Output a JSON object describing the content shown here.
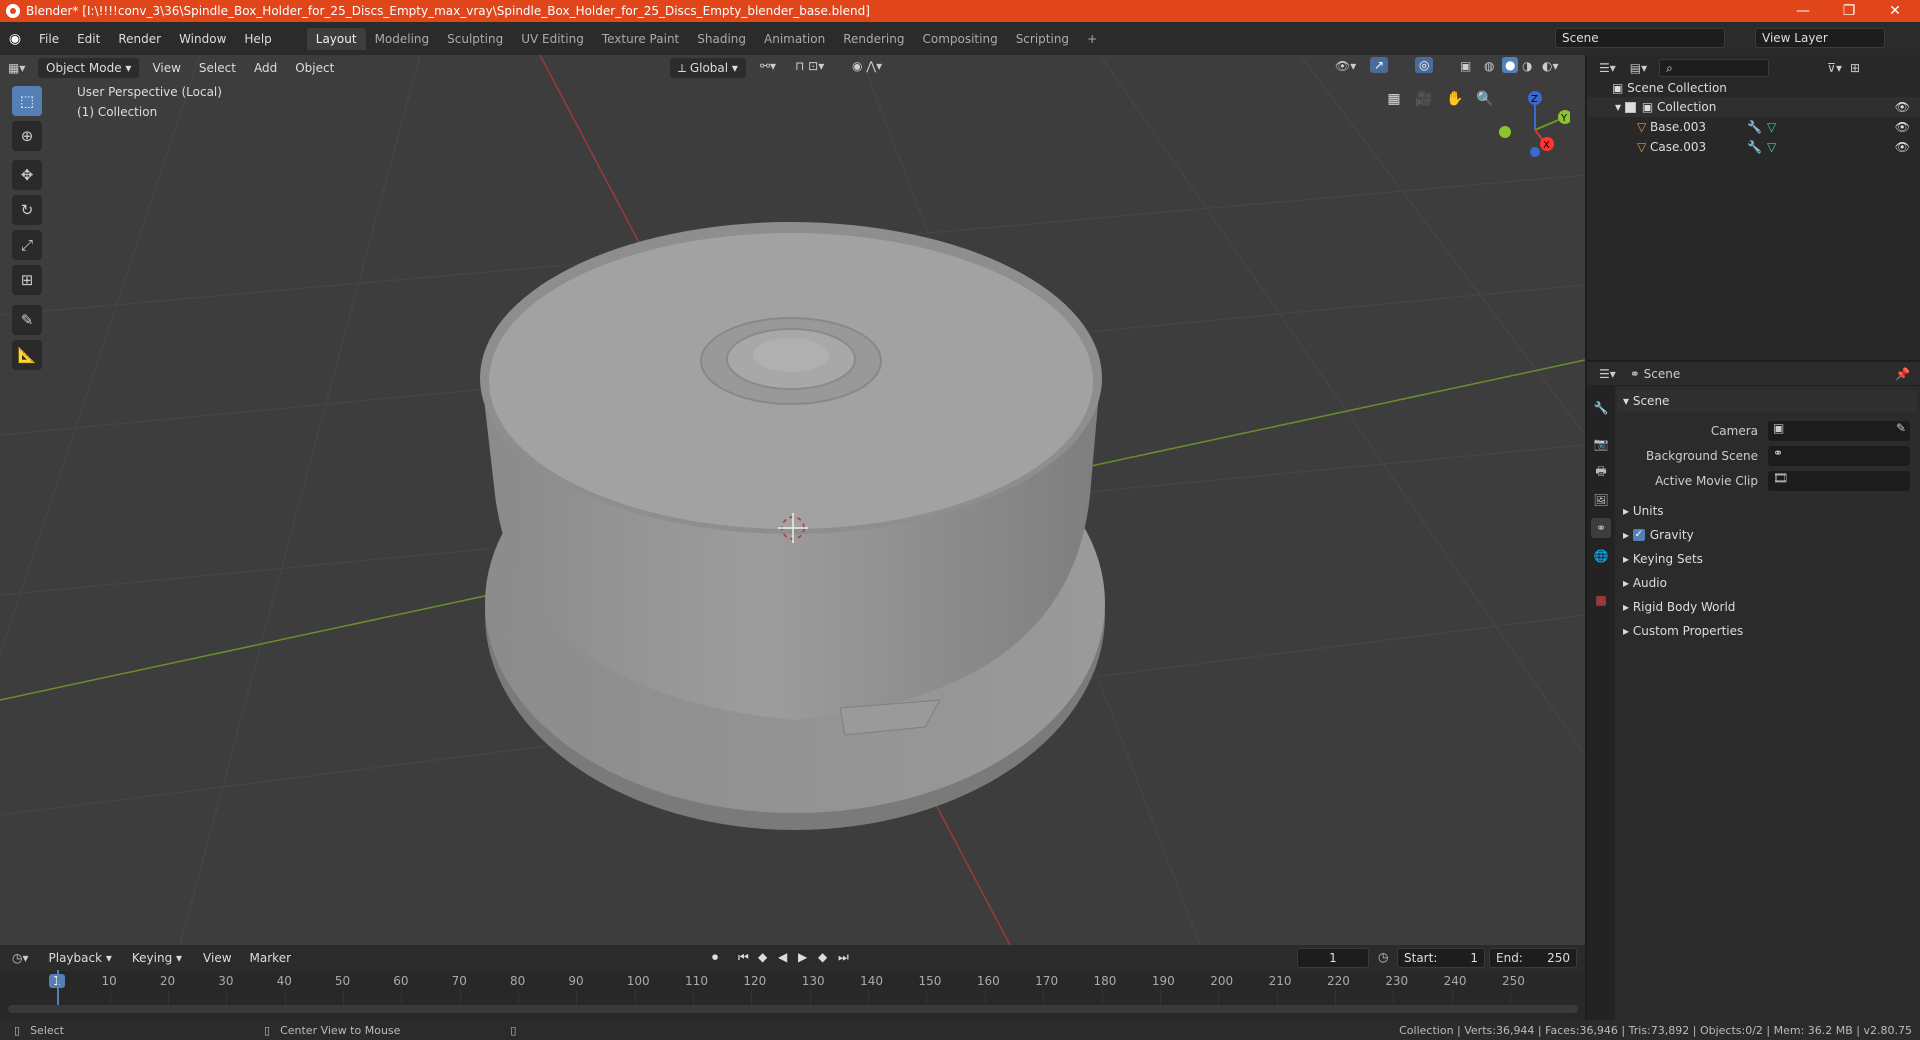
{
  "titlebar": {
    "title": "Blender* [I:\\!!!!conv_3\\36\\Spindle_Box_Holder_for_25_Discs_Empty_max_vray\\Spindle_Box_Holder_for_25_Discs_Empty_blender_base.blend]",
    "accent": "#e1461a"
  },
  "menu": [
    "File",
    "Edit",
    "Render",
    "Window",
    "Help"
  ],
  "workspaces": [
    "Layout",
    "Modeling",
    "Sculpting",
    "UV Editing",
    "Texture Paint",
    "Shading",
    "Animation",
    "Rendering",
    "Compositing",
    "Scripting"
  ],
  "active_workspace": "Layout",
  "scene_field": "Scene",
  "view_layer_field": "View Layer",
  "viewport": {
    "mode": "Object Mode",
    "menus": [
      "View",
      "Select",
      "Add",
      "Object"
    ],
    "orientation": "Global",
    "overlay_line1": "User Perspective (Local)",
    "overlay_line2": "(1) Collection",
    "gizmo": {
      "z": "Z",
      "y": "Y",
      "x": "X"
    }
  },
  "outliner": {
    "root": "Scene Collection",
    "collection": "Collection",
    "items": [
      "Base.003",
      "Case.003"
    ]
  },
  "properties": {
    "header": "Scene",
    "panel": "Scene",
    "fields": [
      {
        "label": "Camera"
      },
      {
        "label": "Background Scene"
      },
      {
        "label": "Active Movie Clip"
      }
    ],
    "sections": [
      "Units",
      "Gravity",
      "Keying Sets",
      "Audio",
      "Rigid Body World",
      "Custom Properties"
    ]
  },
  "timeline": {
    "menus": [
      "Playback",
      "Keying",
      "View",
      "Marker"
    ],
    "current_frame": "1",
    "start_label": "Start:",
    "start": "1",
    "end_label": "End:",
    "end": "250",
    "ticks": [
      "1",
      "10",
      "20",
      "30",
      "40",
      "50",
      "60",
      "70",
      "80",
      "90",
      "100",
      "110",
      "120",
      "130",
      "140",
      "150",
      "160",
      "170",
      "180",
      "190",
      "200",
      "210",
      "220",
      "230",
      "240",
      "250"
    ]
  },
  "status": {
    "left1": "Select",
    "left2": "Center View to Mouse",
    "right": "Collection | Verts:36,944 | Faces:36,946 | Tris:73,892 | Objects:0/2 | Mem: 36.2 MB | v2.80.75"
  }
}
